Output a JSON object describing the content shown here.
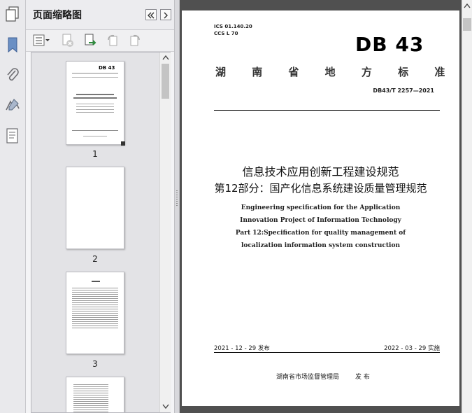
{
  "panel": {
    "title": "页面缩略图",
    "thumbnails": [
      {
        "page": "1"
      },
      {
        "page": "2"
      },
      {
        "page": "3"
      },
      {
        "page": ""
      }
    ]
  },
  "document": {
    "ics_code": "ICS 01.140.20",
    "ccs_code": "CCS L 70",
    "logo_text": "DB 43",
    "province_standard": "湖 南 省 地 方 标 准",
    "standard_number": "DB43/T 2257—2021",
    "title_cn_line1": "信息技术应用创新工程建设规范",
    "title_cn_line2": "第12部分：国产化信息系统建设质量管理规范",
    "title_en_line1": "Engineering specification for the Application",
    "title_en_line2": "Innovation Project of Information Technology",
    "title_en_line3": "Part 12:Specification for quality management of",
    "title_en_line4": "localization information system construction",
    "issue_date": "2021 - 12 - 29 发布",
    "implement_date": "2022 - 03 - 29 实施",
    "issuer": "湖南省市场监督管理局",
    "issuer_action": "发 布"
  },
  "colors": {
    "panel_bg": "#f4f4f6",
    "doc_bg": "#505050",
    "page_bg": "#ffffff"
  }
}
